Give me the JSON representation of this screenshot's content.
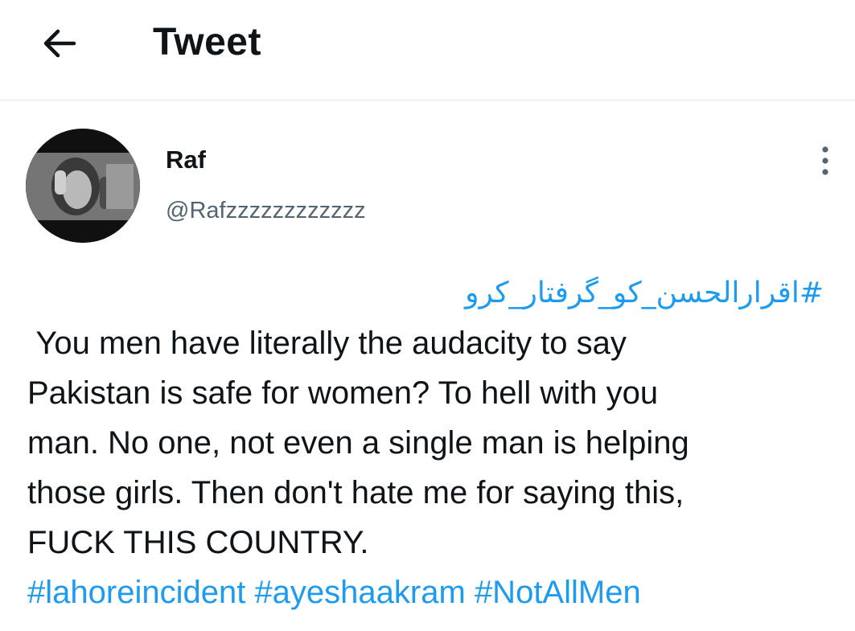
{
  "header": {
    "back_icon": "arrow-left-icon",
    "title": "Tweet"
  },
  "author": {
    "name": "Raf",
    "handle": "@Rafzzzzzzzzzzzz",
    "more_icon": "more-vertical-icon"
  },
  "tweet": {
    "urdu_hashtag": "#اقرارالحسن_کو_گرفتار_کرو",
    "lines": [
      " You men have literally the audacity to say",
      "Pakistan is safe for women? To hell with you",
      "man. No one, not even a single man is helping",
      "those girls. Then don't hate me for saying this,",
      "FUCK THIS COUNTRY."
    ],
    "hashtags": [
      "#lahoreincident",
      "#ayeshaakram",
      "#NotAllMen"
    ]
  },
  "colors": {
    "link": "#1d9bf0",
    "secondary_text": "#536471",
    "primary_text": "#0f1419",
    "divider": "#e6e9eb"
  }
}
